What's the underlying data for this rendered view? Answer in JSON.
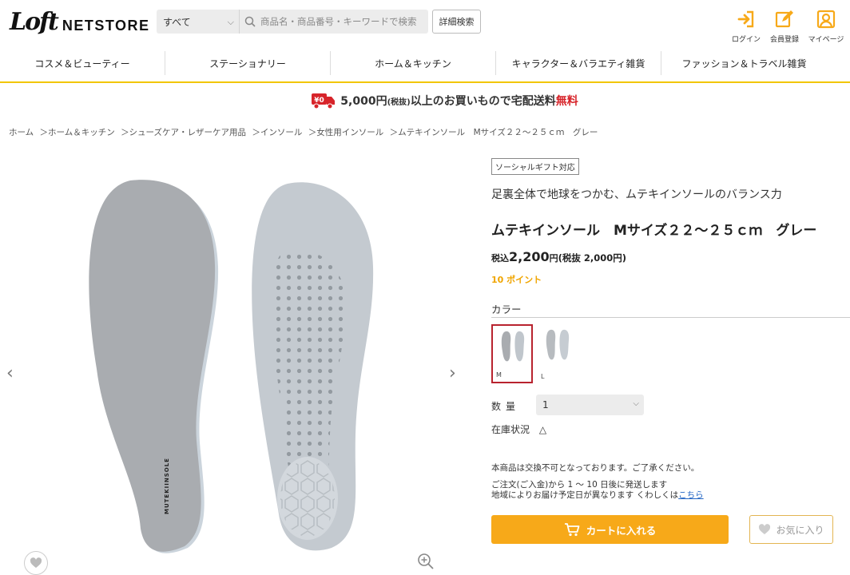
{
  "header": {
    "logo_mark": "Loft",
    "logo_text": "NETSTORE",
    "search_category": "すべて",
    "search_placeholder": "商品名・商品番号・キーワードで検索",
    "advanced_search": "詳細検索",
    "login": "ログイン",
    "register": "会員登録",
    "mypage": "マイページ",
    "accent_color": "#f7a919"
  },
  "nav": {
    "items": [
      {
        "label": "コスメ＆ビューティー"
      },
      {
        "label": "ステーショナリー"
      },
      {
        "label": "ホーム＆キッチン"
      },
      {
        "label": "キャラクター＆バラエティ雑貨"
      },
      {
        "label": "ファッション＆トラベル雑貨"
      }
    ]
  },
  "banner": {
    "badge": "¥0",
    "amount": "5,000円",
    "tax": "(税抜)",
    "middle": "以上のお買いもので宅配送料",
    "free": "無料"
  },
  "breadcrumb": [
    "ホーム",
    "＞ホーム＆キッチン",
    "＞シューズケア・レザーケア用品",
    "＞インソール",
    "＞女性用インソール",
    "＞ムテキインソール　Mサイズ２２～２５ｃｍ　グレー"
  ],
  "product": {
    "tag": "ソーシャルギフト対応",
    "catch": "足裏全体で地球をつかむ、ムテキインソールのバランス力",
    "title": "ムテキインソール　Mサイズ２２～２５ｃｍ　グレー",
    "price_prefix": "税込",
    "price": "2,200",
    "price_unit": "円",
    "price_excl": "(税抜 2,000円)",
    "points": "10 ポイント",
    "insole_brand": "MUTEKIINSOLE",
    "color_label": "カラー",
    "swatches": [
      {
        "label": "M"
      },
      {
        "label": "L"
      }
    ],
    "quantity_label": "数量",
    "quantity_value": "1",
    "stock_label": "在庫状況",
    "stock_value": "△",
    "note1": "本商品は交換不可となっております。ご了承ください。",
    "note2_line1": "ご注文(ご入金)から 1 ～ 10 日後に発送します",
    "note2_line2": "地域によりお届け予定日が異なります くわしくは",
    "note2_link": "こちら",
    "cart_button": "カートに入れる",
    "fav_button": "お気に入り"
  }
}
